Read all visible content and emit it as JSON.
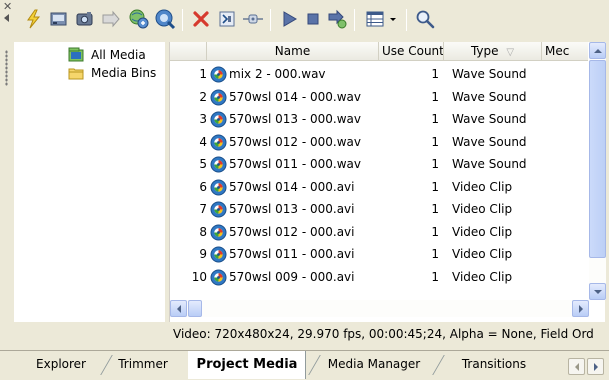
{
  "toolbar": {
    "buttons": [
      {
        "icon": "import-media-icon"
      },
      {
        "icon": "capture-video-icon"
      },
      {
        "icon": "get-photo-icon"
      },
      {
        "icon": "extract-audio-icon"
      },
      {
        "icon": "get-media-from-web-icon"
      },
      {
        "icon": "media-properties-icon"
      },
      {
        "icon": "remove-media-icon"
      },
      {
        "icon": "media-fx-icon"
      },
      {
        "icon": "tag-media-icon"
      },
      {
        "icon": "play-icon"
      },
      {
        "icon": "stop-icon"
      },
      {
        "icon": "auto-preview-icon"
      },
      {
        "icon": "views-icon"
      },
      {
        "icon": "search-icon"
      }
    ]
  },
  "tree": {
    "items": [
      {
        "label": "All Media",
        "icon": "all-media-icon"
      },
      {
        "label": "Media Bins",
        "icon": "folder-icon"
      }
    ]
  },
  "list": {
    "columns": [
      "Name",
      "Use Count",
      "Type",
      "Mec"
    ],
    "sort_indicator": "▽",
    "rows": [
      {
        "num": "1",
        "name": "mix 2 - 000.wav",
        "use_count": "1",
        "type": "Wave Sound"
      },
      {
        "num": "2",
        "name": "570wsl 014 - 000.wav",
        "use_count": "1",
        "type": "Wave Sound"
      },
      {
        "num": "3",
        "name": "570wsl 013 - 000.wav",
        "use_count": "1",
        "type": "Wave Sound"
      },
      {
        "num": "4",
        "name": "570wsl 012 - 000.wav",
        "use_count": "1",
        "type": "Wave Sound"
      },
      {
        "num": "5",
        "name": "570wsl 011 - 000.wav",
        "use_count": "1",
        "type": "Wave Sound"
      },
      {
        "num": "6",
        "name": "570wsl 014 - 000.avi",
        "use_count": "1",
        "type": "Video Clip"
      },
      {
        "num": "7",
        "name": "570wsl 013 - 000.avi",
        "use_count": "1",
        "type": "Video Clip"
      },
      {
        "num": "8",
        "name": "570wsl 012 - 000.avi",
        "use_count": "1",
        "type": "Video Clip"
      },
      {
        "num": "9",
        "name": "570wsl 011 - 000.avi",
        "use_count": "1",
        "type": "Video Clip"
      },
      {
        "num": "10",
        "name": "570wsl 009 - 000.avi",
        "use_count": "1",
        "type": "Video Clip"
      }
    ]
  },
  "status": {
    "text": "Video: 720x480x24, 29.970 fps, 00:00:45;24, Alpha = None, Field Ord"
  },
  "tabs": [
    {
      "label": "Explorer",
      "selected": false
    },
    {
      "label": "Trimmer",
      "selected": false
    },
    {
      "label": "Project Media",
      "selected": true
    },
    {
      "label": "Media Manager",
      "selected": false
    },
    {
      "label": "Transitions",
      "selected": false
    }
  ],
  "colors": {
    "window_bg": "#ece9d8",
    "scroll_accent": "#b9cdf6",
    "delete_red": "#d63a2e"
  }
}
